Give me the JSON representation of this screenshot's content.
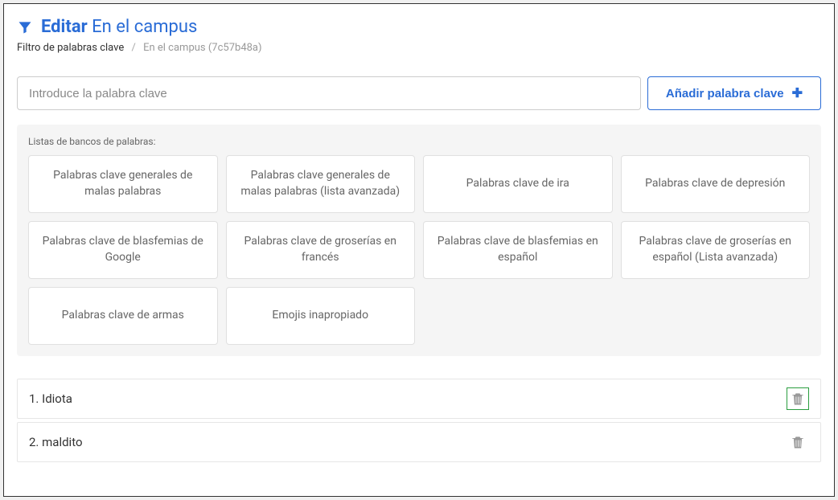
{
  "header": {
    "title_bold": "Editar",
    "title_light": "En el campus"
  },
  "breadcrumb": {
    "root": "Filtro de palabras clave",
    "current": "En el campus (7c57b48a)"
  },
  "input": {
    "placeholder": "Introduce la palabra clave",
    "add_button_label": "Añadir palabra clave"
  },
  "bank": {
    "label": "Listas de bancos de palabras:",
    "items": [
      "Palabras clave generales de malas palabras",
      "Palabras clave generales de malas palabras (lista avanzada)",
      "Palabras clave de ira",
      "Palabras clave de depresión",
      "Palabras clave de blasfemias de Google",
      "Palabras clave de groserías en francés",
      "Palabras clave de blasfemias en español",
      "Palabras clave de groserías en español (Lista avanzada)",
      "Palabras clave de armas",
      "Emojis inapropiado"
    ]
  },
  "keywords": [
    {
      "index": "1.",
      "text": "Idiota",
      "highlighted": true
    },
    {
      "index": "2.",
      "text": "maldito",
      "highlighted": false
    }
  ]
}
